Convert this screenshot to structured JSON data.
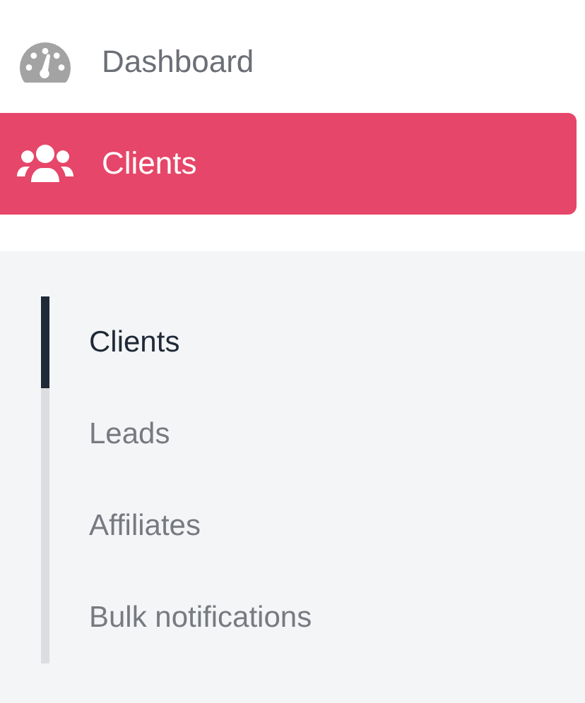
{
  "nav": [
    {
      "label": "Dashboard",
      "kind": "gauge",
      "selected": false
    },
    {
      "label": "Clients",
      "kind": "users",
      "selected": true
    }
  ],
  "subnav": [
    {
      "label": "Clients",
      "selected": true
    },
    {
      "label": "Leads",
      "selected": false
    },
    {
      "label": "Affiliates",
      "selected": false
    },
    {
      "label": "Bulk notifications",
      "selected": false
    }
  ]
}
